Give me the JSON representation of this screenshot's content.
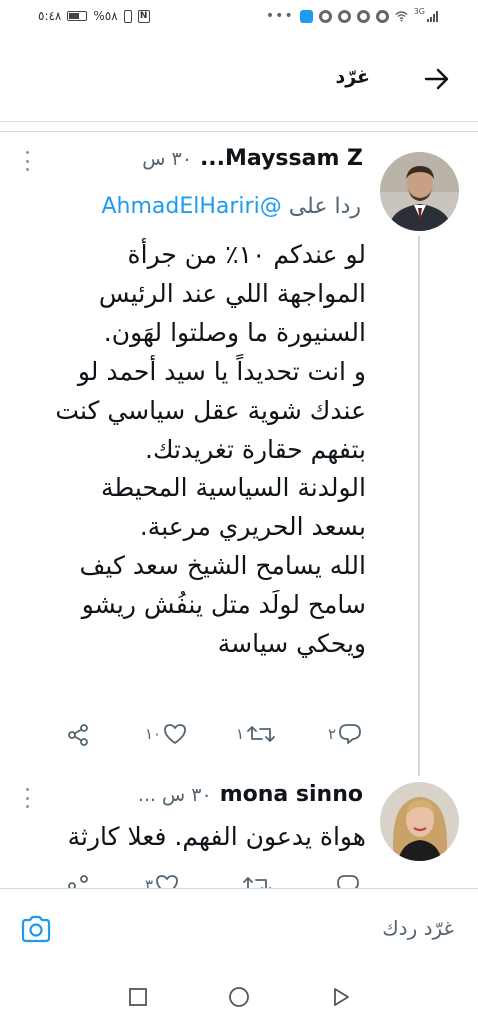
{
  "status_bar": {
    "time": "٥:٤٨",
    "battery": "%٥٨",
    "network": "3G"
  },
  "header": {
    "title": "غرّد"
  },
  "tweets": [
    {
      "name": "Mayssam Z...",
      "time": "٣٠ س",
      "reply_label": "ردا على",
      "reply_handle": "@AhmadElHariri",
      "lines": [
        "لو عندكم ١٠٪ من جرأة",
        "المواجهة اللي عند الرئيس",
        "السنيورة ما وصلتوا لهَون.",
        "و انت تحديداً يا سيد أحمد لو",
        "عندك شوية عقل سياسي كنت",
        "بتفهم حقارة تغريدتك.",
        "الولدنة السياسية المحيطة",
        "بسعد الحريري مرعبة.",
        "الله يسامح الشيخ سعد كيف",
        "سامح لولَد متل ينفُش ريشو",
        "ويحكي سياسة"
      ],
      "replies_count": "٢",
      "retweets_count": "١",
      "likes_count": "١٠"
    },
    {
      "name": "mona sinno",
      "time": "٣٠ س ...",
      "lines": [
        "هواة يدعون الفهم. فعلا كارثة"
      ],
      "retweets_count": "",
      "likes_count": "٣"
    }
  ],
  "reply_bar": {
    "placeholder": "غرّد ردك"
  },
  "colors": {
    "accent": "#1d9bf0",
    "muted": "#536471",
    "text": "#0f1419"
  }
}
